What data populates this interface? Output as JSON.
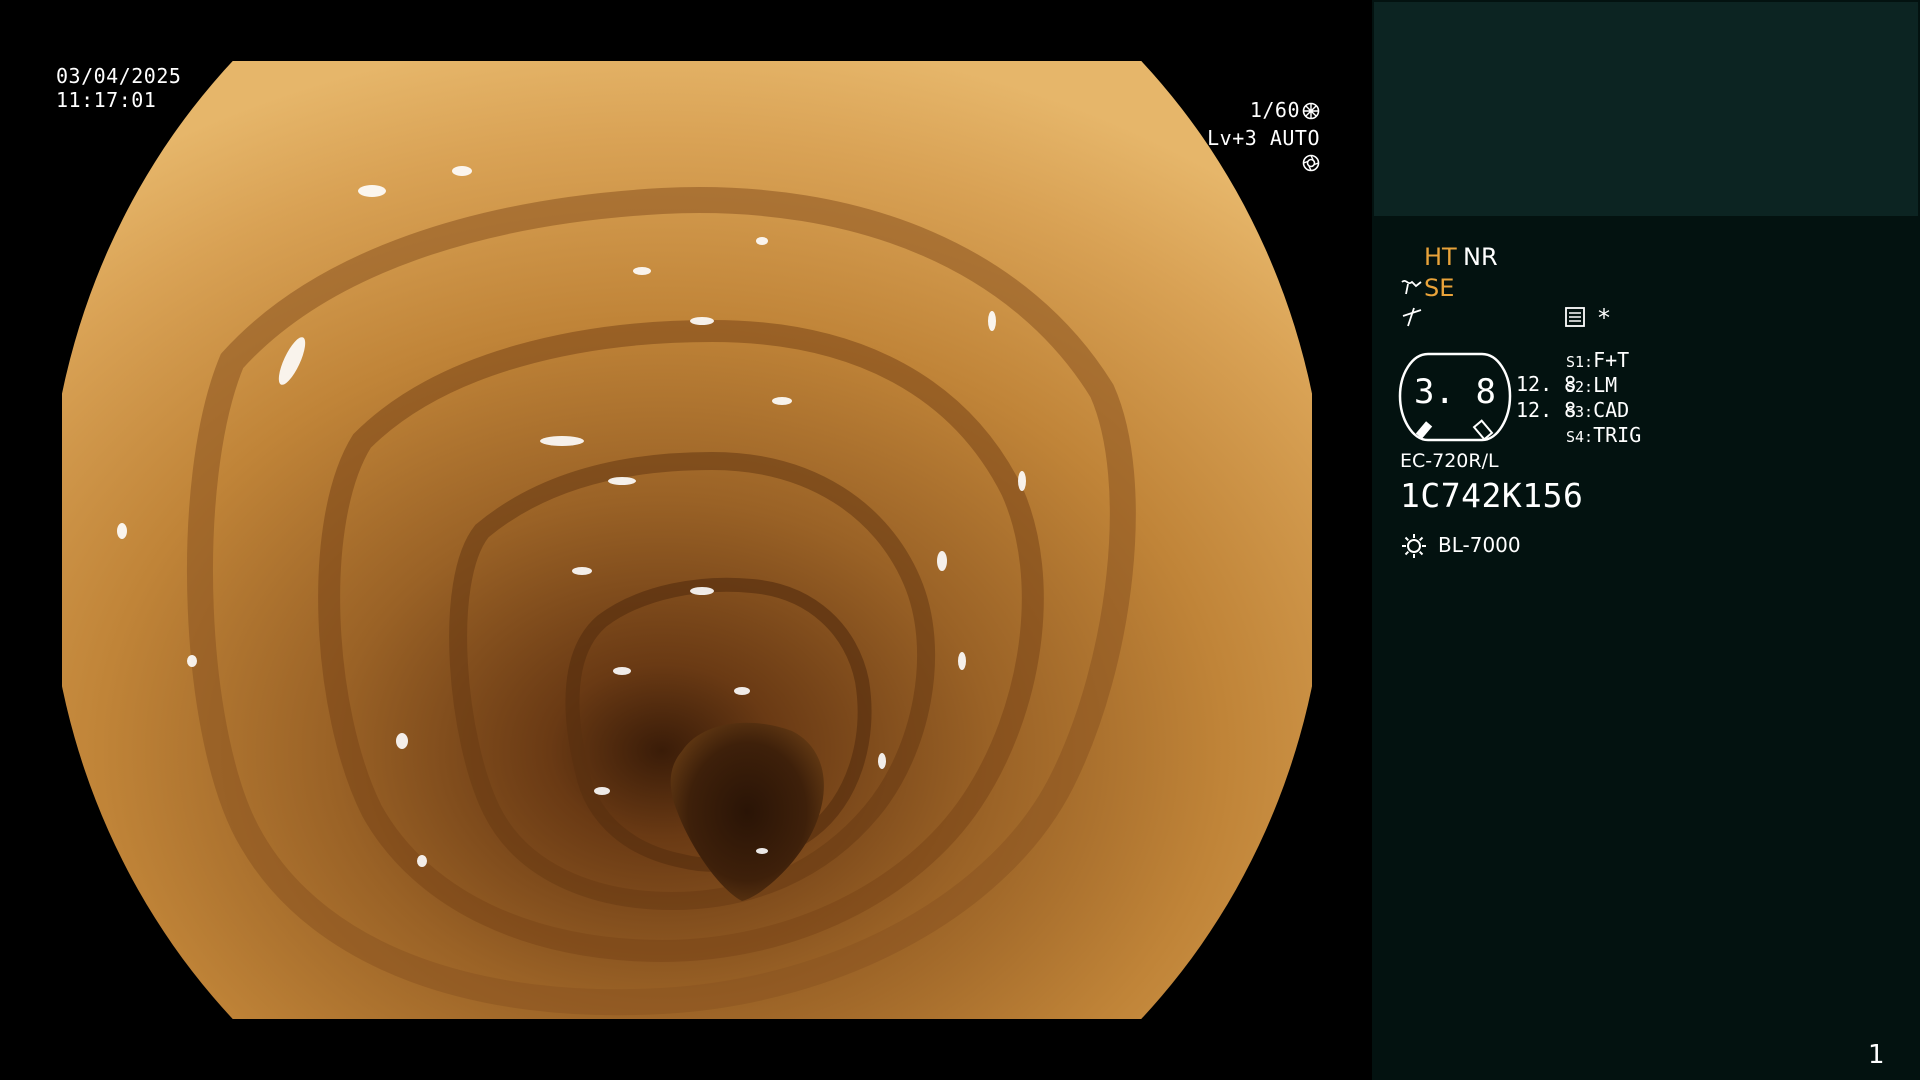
{
  "osd": {
    "date": "03/04/2025",
    "time": "11:17:01",
    "shutter": "1/60",
    "shutter_icon": "aperture-icon",
    "level": "Lv+3 AUTO",
    "iris_icon": "iris-icon"
  },
  "panel": {
    "ht": "HT",
    "nr": "NR",
    "se": "SE",
    "se_icon": "structure-enhance-icon",
    "enhance_icon": "edge-enhance-icon",
    "memo_icon": "memo-icon",
    "star": "*",
    "gauge_value": "3. 8",
    "value_a": "12. 8",
    "value_b": "12. 8",
    "settings": [
      {
        "key": "S1:",
        "value": "F+T"
      },
      {
        "key": "S2:",
        "value": "LM"
      },
      {
        "key": "S3:",
        "value": "CAD"
      },
      {
        "key": "S4:",
        "value": "TRIG"
      }
    ],
    "model": "EC-720R/L",
    "serial": "1C742K156",
    "light_icon": "sun-icon",
    "light_source": "BL-7000",
    "page_number": "1"
  },
  "colors": {
    "accent_orange": "#e9a33a",
    "panel_bg": "#031210",
    "panel_top_bg": "#0c2422"
  }
}
